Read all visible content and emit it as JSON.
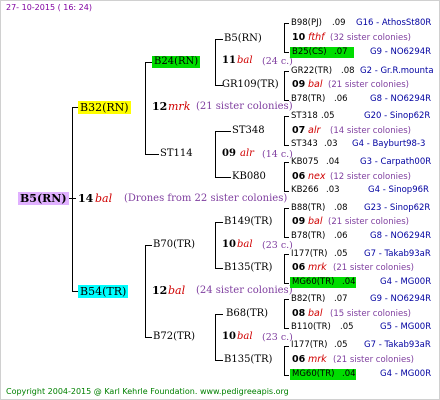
{
  "header": {
    "date": "27- 10-2015 ( 16: 24)"
  },
  "footer": {
    "copyright": "Copyright 2004-2015 @ Karl Kehrle Foundation.   www.pedigreeapis.org"
  },
  "colors": {
    "root": "#e0b0ff",
    "gold": "#ffff00",
    "cyan": "#00ffff",
    "green": "#00dd00"
  },
  "root": {
    "name": "B5(RN)",
    "year": "14",
    "code": "bal",
    "note": "(Drones from 22 sister colonies)"
  },
  "gen1": {
    "top": {
      "name": "B32(RN)",
      "year": "12",
      "code": "mrk",
      "note": "(21 sister colonies)"
    },
    "bottom": {
      "name": "B54(TR)",
      "year": "12",
      "code": "bal",
      "note": "(24 sister colonies)"
    }
  },
  "gen2": {
    "a": {
      "name": "B24(RN)",
      "year": "11",
      "code": "bal",
      "note": "(24 c.)"
    },
    "b": {
      "name": "ST114",
      "year": "09",
      "code": "alr",
      "note": "(14 c.)"
    },
    "c": {
      "name": "B70(TR)",
      "year": "10",
      "code": "bal",
      "note": "(23 c.)"
    },
    "d": {
      "name": "B72(TR)",
      "year": "10",
      "code": "bal",
      "note": "(23 c.)"
    }
  },
  "gen3": [
    {
      "name": "B5(RN)",
      "year": "10",
      "code": "fthf",
      "note": "(32 sister colonies)"
    },
    {
      "name": "GR109(TR)",
      "year": "09",
      "code": "bal",
      "note": "(21 sister colonies)"
    },
    {
      "name": "ST348",
      "year": "07",
      "code": "alr",
      "note": "(14 sister colonies)"
    },
    {
      "name": "KB080",
      "year": "06",
      "code": "nex",
      "note": "(12 sister colonies)"
    },
    {
      "name": "B149(TR)",
      "year": "09",
      "code": "bal",
      "note": "(21 sister colonies)"
    },
    {
      "name": "B135(TR)",
      "year": "06",
      "code": "mrk",
      "note": "(21 sister colonies)"
    },
    {
      "name": "B68(TR)",
      "year": "08",
      "code": "bal",
      "note": "(15 sister colonies)"
    },
    {
      "name": "B135(TR)",
      "year": "06",
      "code": "mrk",
      "note": "(21 sister colonies)"
    }
  ],
  "gen4": [
    {
      "name": "B98(PJ)",
      "yr": ".09",
      "code": "G16 - AthosSt80R"
    },
    {
      "name": "B25(CS)",
      "yr": ".07",
      "code": "G9 - NO6294R"
    },
    {
      "name": "GR22(TR)",
      "yr": ".08",
      "code": "G2 - Gr.R.mounta"
    },
    {
      "name": "B78(TR)",
      "yr": ".06",
      "code": "G8 - NO6294R"
    },
    {
      "name": "ST318",
      "yr": ".05",
      "code": "G20 - Sinop62R"
    },
    {
      "name": "ST343",
      "yr": ".03",
      "code": "G4 - Bayburt98-3"
    },
    {
      "name": "KB075",
      "yr": ".04",
      "code": "G3 - Carpath00R"
    },
    {
      "name": "KB266",
      "yr": ".03",
      "code": "G4 - Sinop96R"
    },
    {
      "name": "B88(TR)",
      "yr": ".08",
      "code": "G23 - Sinop62R"
    },
    {
      "name": "B78(TR)",
      "yr": ".06",
      "code": "G8 - NO6294R"
    },
    {
      "name": "I177(TR)",
      "yr": ".05",
      "code": "G7 - Takab93aR"
    },
    {
      "name": "MG60(TR)",
      "yr": ".04",
      "code": "G4 - MG00R"
    },
    {
      "name": "B82(TR)",
      "yr": ".07",
      "code": "G9 - NO6294R"
    },
    {
      "name": "B110(TR)",
      "yr": ".05",
      "code": "G5 - MG00R"
    },
    {
      "name": "I177(TR)",
      "yr": ".05",
      "code": "G7 - Takab93aR"
    },
    {
      "name": "MG60(TR)",
      "yr": ".04",
      "code": "G4 - MG00R"
    }
  ]
}
